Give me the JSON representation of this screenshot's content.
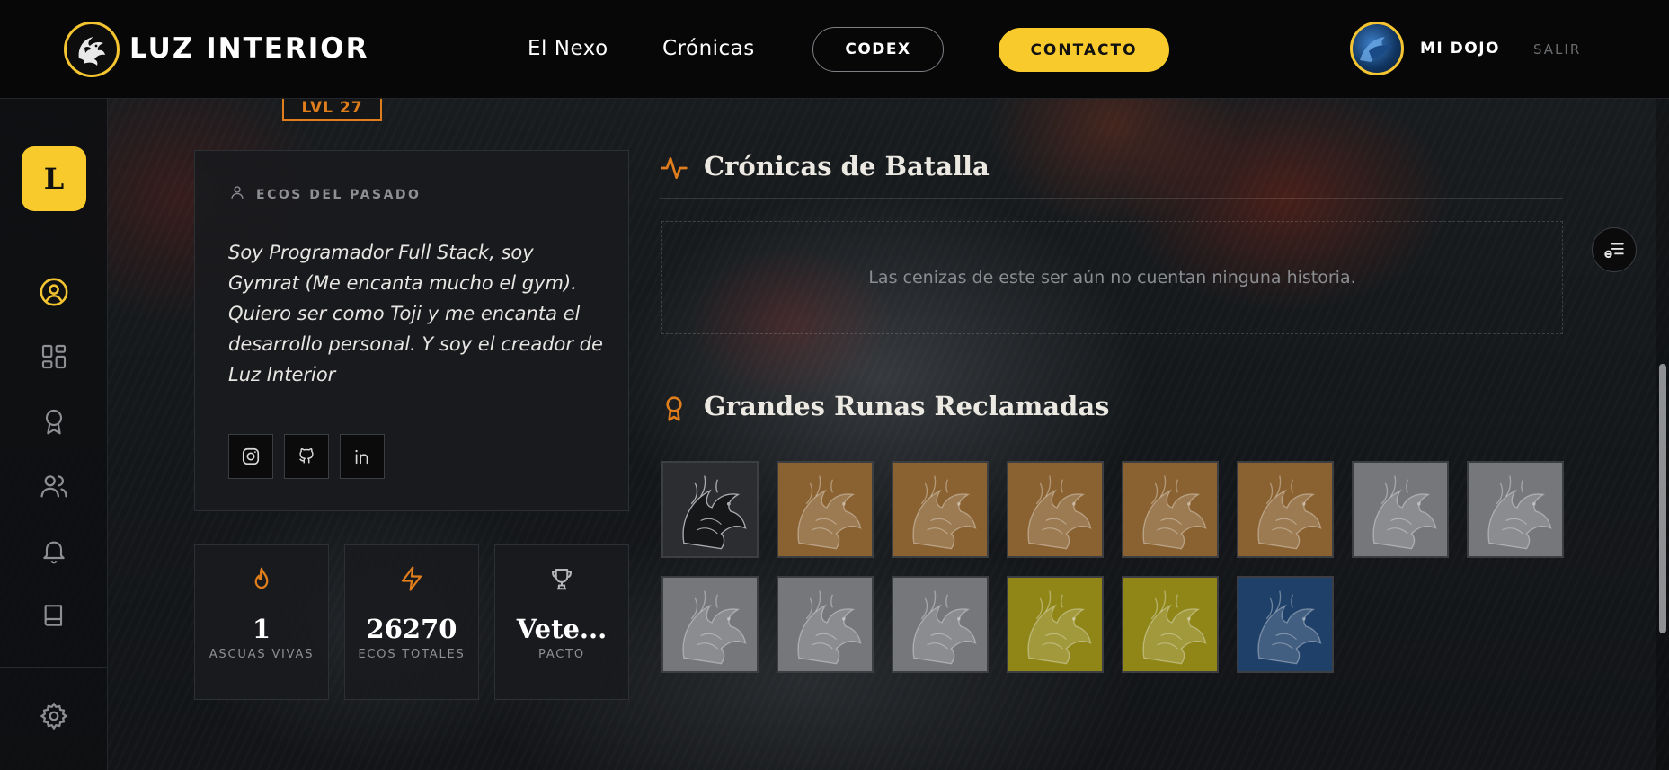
{
  "header": {
    "brand": "LUZ INTERIOR",
    "nav": [
      {
        "label": "El Nexo"
      },
      {
        "label": "Crónicas"
      }
    ],
    "codex_label": "CODEX",
    "contact_label": "CONTACTO",
    "user_label": "MI DOJO",
    "logout_label": "SALIR"
  },
  "sidebar": {
    "avatar_initial": "L",
    "items": [
      {
        "icon": "user-circle-icon",
        "active": true
      },
      {
        "icon": "dashboard-grid-icon",
        "active": false
      },
      {
        "icon": "award-ribbon-icon",
        "active": false
      },
      {
        "icon": "users-group-icon",
        "active": false
      },
      {
        "icon": "bell-icon",
        "active": false
      },
      {
        "icon": "book-icon",
        "active": false
      }
    ],
    "settings_icon": "gear-icon"
  },
  "profile": {
    "level": "LVL 27",
    "bio_label": "ECOS DEL PASADO",
    "bio": "Soy Programador Full Stack, soy Gymrat (Me encanta mucho el gym). Quiero ser como Toji y me encanta el desarrollo personal. Y soy el creador de Luz Interior",
    "socials": [
      "instagram-icon",
      "github-icon",
      "linkedin-icon"
    ]
  },
  "stats": [
    {
      "icon": "flame-icon",
      "value": "1",
      "label": "ASCUAS VIVAS"
    },
    {
      "icon": "lightning-icon",
      "value": "26270",
      "label": "ECOS TOTALES"
    },
    {
      "icon": "trophy-icon",
      "value": "Vete...",
      "label": "PACTO"
    }
  ],
  "chronicles": {
    "title": "Crónicas de Batalla",
    "empty_text": "Las cenizas de este ser aún no cuentan ninguna historia."
  },
  "runes": {
    "title": "Grandes Runas Reclamadas",
    "items": [
      {
        "tier": "obsidian",
        "color": "#2b2d31"
      },
      {
        "tier": "bronze",
        "color": "#8a6231"
      },
      {
        "tier": "bronze",
        "color": "#8a6231"
      },
      {
        "tier": "bronze",
        "color": "#8a6231"
      },
      {
        "tier": "bronze",
        "color": "#8a6231"
      },
      {
        "tier": "bronze",
        "color": "#8a6231"
      },
      {
        "tier": "silver",
        "color": "#75777b"
      },
      {
        "tier": "silver",
        "color": "#75777b"
      },
      {
        "tier": "silver",
        "color": "#75777b"
      },
      {
        "tier": "silver",
        "color": "#75777b"
      },
      {
        "tier": "silver",
        "color": "#75777b"
      },
      {
        "tier": "gold",
        "color": "#8f8617"
      },
      {
        "tier": "gold",
        "color": "#8f8617"
      },
      {
        "tier": "sapphire",
        "color": "#1e4069"
      }
    ]
  },
  "colors": {
    "accent": "#f8ca2c",
    "ember": "#e07d1c"
  }
}
